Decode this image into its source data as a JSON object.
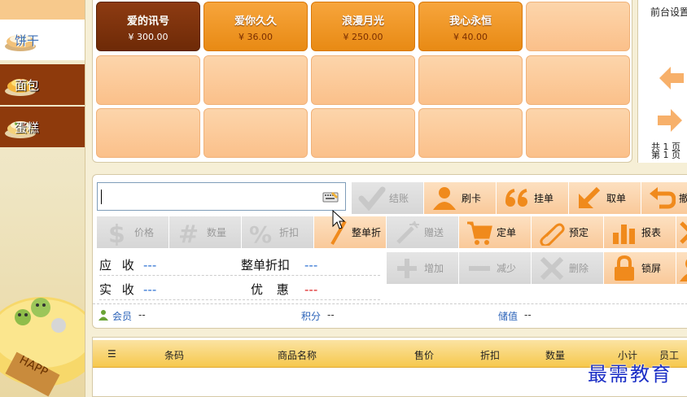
{
  "sidebar": {
    "items": [
      {
        "label": "饼干",
        "icon": "cookie-cake-icon",
        "state": "active"
      },
      {
        "label": "面包",
        "icon": "bread-cake-icon",
        "state": "normal"
      },
      {
        "label": "蛋糕",
        "icon": "cake-icon",
        "state": "normal"
      }
    ]
  },
  "products": [
    {
      "name": "爱的讯号",
      "price": "¥ 300.00",
      "selected": true
    },
    {
      "name": "爱你久久",
      "price": "¥ 36.00",
      "selected": false
    },
    {
      "name": "浪漫月光",
      "price": "¥ 250.00",
      "selected": false
    },
    {
      "name": "我心永恒",
      "price": "¥ 40.00",
      "selected": false
    }
  ],
  "right_panel": {
    "title": "前台设置",
    "pages_line1": "共 1 页",
    "pages_line2": "第 1 页",
    "up_icon": "arrow-left-icon",
    "down_icon": "arrow-right-icon"
  },
  "search": {
    "value": "",
    "placeholder": "",
    "icon": "keyboard-icon"
  },
  "toolbar": {
    "row1": [
      {
        "label": "结账",
        "icon": "check-icon",
        "disabled": true
      },
      {
        "label": "刷卡",
        "icon": "member-card-icon",
        "disabled": false
      },
      {
        "label": "挂单",
        "icon": "quote-icon",
        "disabled": false
      },
      {
        "label": "取单",
        "icon": "arrow-down-left-icon",
        "disabled": false
      },
      {
        "label": "撤",
        "icon": "undo-icon",
        "disabled": false
      }
    ],
    "row2": [
      {
        "label": "价格",
        "icon": "dollar-icon",
        "disabled": true
      },
      {
        "label": "数量",
        "icon": "hash-icon",
        "disabled": true
      },
      {
        "label": "折扣",
        "icon": "percent-icon",
        "disabled": true
      },
      {
        "label": "整单折",
        "icon": "pen-icon",
        "disabled": false
      },
      {
        "label": "赠送",
        "icon": "magic-wand-icon",
        "disabled": true
      },
      {
        "label": "定单",
        "icon": "cart-icon",
        "disabled": false
      },
      {
        "label": "预定",
        "icon": "paperclip-icon",
        "disabled": false
      },
      {
        "label": "报表",
        "icon": "bar-chart-icon",
        "disabled": false
      },
      {
        "label": "",
        "icon": "close-icon",
        "disabled": false
      }
    ],
    "row3": [
      {
        "label": "增加",
        "icon": "plus-icon",
        "disabled": true
      },
      {
        "label": "减少",
        "icon": "minus-icon",
        "disabled": true
      },
      {
        "label": "删除",
        "icon": "delete-x-icon",
        "disabled": true
      },
      {
        "label": "锁屏",
        "icon": "lock-icon",
        "disabled": false
      },
      {
        "label": "",
        "icon": "user-icon",
        "disabled": false
      }
    ]
  },
  "summary": {
    "receivable_label": "应 收",
    "receivable_value": "---",
    "discount_label": "整单折扣",
    "discount_value": "---",
    "paid_label": "实 收",
    "paid_value": "---",
    "coupon_label": "优 惠",
    "coupon_value": "---"
  },
  "member": {
    "member_label": "会员",
    "member_value": "--",
    "points_label": "积分",
    "points_value": "--",
    "stored_label": "储值",
    "stored_value": "--",
    "icon": "member-icon"
  },
  "table": {
    "columns": [
      "☰",
      "条码",
      "商品名称",
      "售价",
      "折扣",
      "数量",
      "小计",
      "员工"
    ]
  },
  "watermark": "最需教育",
  "colors": {
    "accent": "#f39a2a",
    "selected": "#7a300a",
    "tile_empty": "#fcc896",
    "button_bg": "#fbd3aa",
    "icon_orange": "#f08a1c",
    "icon_gray": "#c8c8c8",
    "sidebar_dark": "#8e3a0c"
  }
}
